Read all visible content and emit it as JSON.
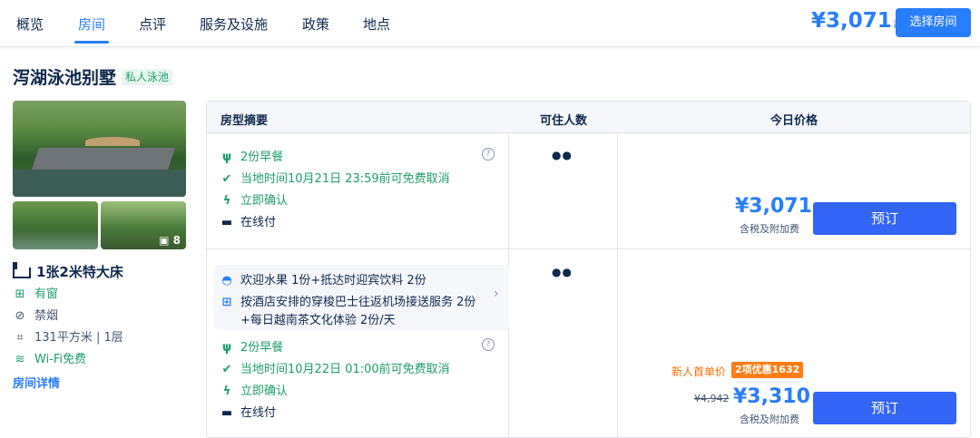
{
  "nav": {
    "tabs": [
      "概览",
      "房间",
      "点评",
      "服务及设施",
      "政策",
      "地点"
    ],
    "active_index": 1,
    "price": "¥3,071",
    "price_suffix": "起",
    "select_button": "选择房间"
  },
  "room": {
    "title": "泻湖泳池别墅",
    "tag": "私人泳池",
    "photo_count": "8",
    "bed": "1张2米特大床",
    "features": [
      {
        "icon": "window-icon",
        "text": "有窗",
        "highlight": true
      },
      {
        "icon": "no-smoking-icon",
        "text": "禁烟",
        "highlight": false
      },
      {
        "icon": "area-icon",
        "text": "131平方米 | 1层",
        "highlight": false
      },
      {
        "icon": "wifi-icon",
        "text": "Wi-Fi免费",
        "highlight": true
      }
    ],
    "details_link": "房间详情"
  },
  "table": {
    "headers": [
      "房型摘要",
      "可住人数",
      "今日价格"
    ],
    "rates": [
      {
        "items": [
          {
            "icon": "meal-icon",
            "text": "2份早餐",
            "color": "#1c9e6a"
          },
          {
            "icon": "check-circle-icon",
            "text": "当地时间10月21日 23:59前可免费取消",
            "color": "#1c9e6a"
          },
          {
            "icon": "lightning-icon",
            "text": "立即确认",
            "color": "#1c9e6a"
          },
          {
            "icon": "card-icon",
            "text": "在线付",
            "color": "#0f294d"
          }
        ],
        "persons": "2",
        "price": "¥3,071",
        "price_note": "含税及附加费",
        "book": "预订"
      },
      {
        "gifts": [
          {
            "icon": "service-bell-icon",
            "text": "欢迎水果 1份+抵达时迎宾饮料 2份"
          },
          {
            "icon": "gift-icon",
            "text": "按酒店安排的穿梭巴士往返机场接送服务 2份"
          },
          {
            "icon": "",
            "text": "+每日越南茶文化体验 2份/天"
          }
        ],
        "items": [
          {
            "icon": "meal-icon",
            "text": "2份早餐",
            "color": "#1c9e6a"
          },
          {
            "icon": "check-circle-icon",
            "text": "当地时间10月22日 01:00前可免费取消",
            "color": "#1c9e6a"
          },
          {
            "icon": "lightning-icon",
            "text": "立即确认",
            "color": "#1c9e6a"
          },
          {
            "icon": "card-icon",
            "text": "在线付",
            "color": "#0f294d"
          }
        ],
        "persons": "2",
        "new_user": "新人首单价",
        "discount_badge": "2项优惠1632",
        "original_price": "¥4,942",
        "price": "¥3,310",
        "price_note": "含税及附加费",
        "book": "预订"
      }
    ]
  },
  "colors": {
    "accent": "#287dfa",
    "green": "#1c9e6a",
    "orange": "#ff7d13",
    "button": "#3264f5"
  }
}
